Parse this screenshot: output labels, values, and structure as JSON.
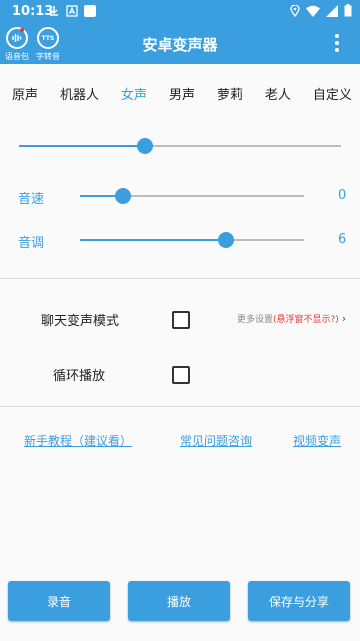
{
  "status_bar": {
    "time": "10:13"
  },
  "app_bar": {
    "title": "安卓变声器",
    "tool_voice_pack": "语音包",
    "tool_tts": "字转音",
    "tts_icon_text": "TTS"
  },
  "voice_tabs": {
    "items": [
      "原声",
      "机器人",
      "女声",
      "男声",
      "萝莉",
      "老人",
      "自定义"
    ],
    "active": "女声"
  },
  "controls": {
    "main_slider_level": 0.39,
    "speed": {
      "label": "音速",
      "value": "0",
      "level": 0.19
    },
    "pitch": {
      "label": "音调",
      "value": "6",
      "level": 0.65
    }
  },
  "options": {
    "chat_mode_label": "聊天变声模式",
    "chat_mode_checked": false,
    "more_settings": "更多设置",
    "more_settings_hint": "(悬浮窗不显示?)",
    "more_arrow": "›",
    "loop_label": "循环播放",
    "loop_checked": false
  },
  "links": {
    "tutorial": "新手教程（建议看）",
    "faq": "常见问题咨询",
    "video": "视频变声"
  },
  "buttons": {
    "record": "录音",
    "play": "播放",
    "save_share": "保存与分享"
  },
  "colors": {
    "accent": "#3b9fdf",
    "hint_red": "#e53935"
  }
}
